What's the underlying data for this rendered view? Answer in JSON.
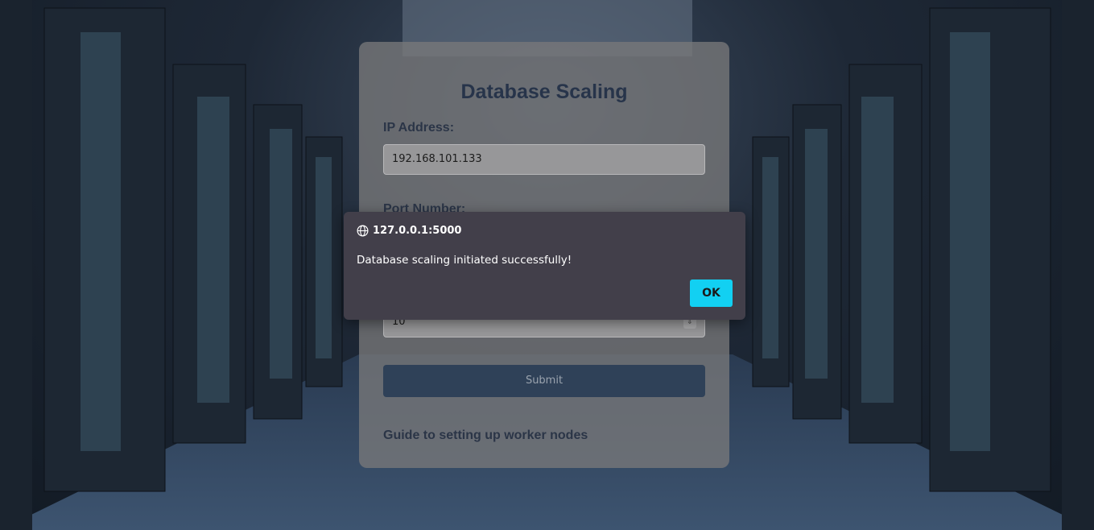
{
  "form": {
    "title": "Database Scaling",
    "ip_label": "IP Address:",
    "ip_value": "192.168.101.133",
    "port_label": "Port Number:",
    "nodes_value": "10",
    "submit_label": "Submit",
    "guide_link": "Guide to setting up worker nodes"
  },
  "dialog": {
    "origin": "127.0.0.1:5000",
    "message": "Database scaling initiated successfully!",
    "ok_label": "OK",
    "icon": "globe-icon"
  },
  "colors": {
    "ok_button": "#12d0f2",
    "submit_button": "#2f4158",
    "dialog_bg": "#423f4a",
    "title": "#27344a"
  }
}
